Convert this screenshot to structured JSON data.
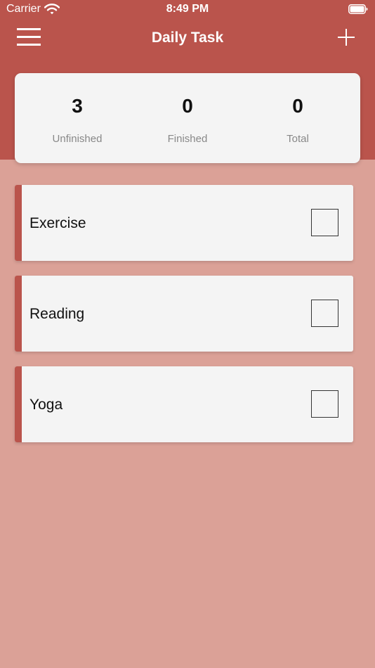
{
  "status_bar": {
    "carrier": "Carrier",
    "time": "8:49 PM",
    "wifi_icon": "wifi-icon",
    "battery_icon": "battery-icon"
  },
  "nav": {
    "title": "Daily Task",
    "menu_icon": "hamburger-menu-icon",
    "add_icon": "plus-icon"
  },
  "stats": {
    "unfinished": {
      "value": "3",
      "label": "Unfinished"
    },
    "finished": {
      "value": "0",
      "label": "Finished"
    },
    "total": {
      "value": "0",
      "label": "Total"
    }
  },
  "tasks": [
    {
      "label": "Exercise",
      "checked": false
    },
    {
      "label": "Reading",
      "checked": false
    },
    {
      "label": "Yoga",
      "checked": false
    }
  ],
  "colors": {
    "header": "#ba544c",
    "background": "#dba197",
    "card": "#f4f4f4",
    "accent": "#ba544c"
  }
}
